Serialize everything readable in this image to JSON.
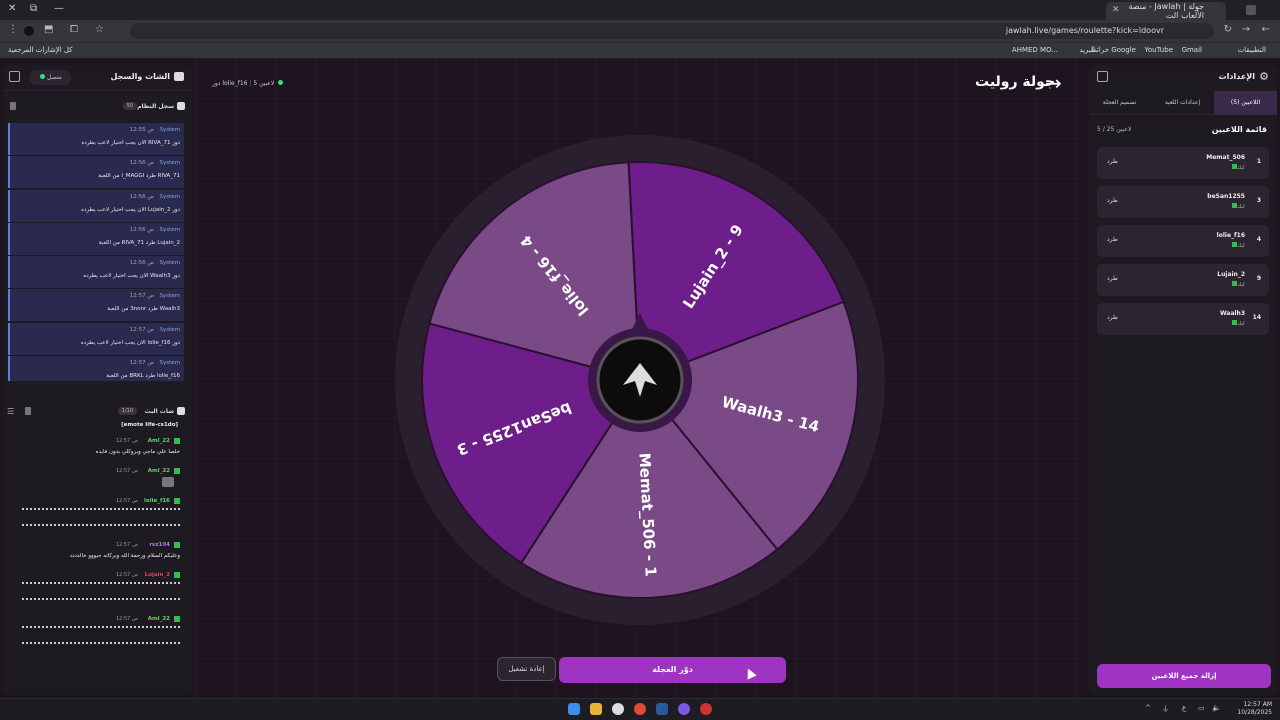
{
  "browser": {
    "tab_title": "جولة | Jawlah - منصة الألعاب الت",
    "url": "jawlah.live/games/roulette?kick=ldoovr",
    "bookmarks": [
      "التطبيقات",
      "Gmail",
      "YouTube",
      "خرائط Google",
      "البريد",
      "AHMED MO...",
      "كل الإشارات المرجعية"
    ]
  },
  "left_panel": {
    "title": "الشات والسجل",
    "online_label": "متصل",
    "system_log": {
      "title": "سجل النظام",
      "count": "50",
      "entries": [
        {
          "source": "System",
          "time": "12:55 ص",
          "message": "دور RIVA_71 الان يجب اختيار لاعب يطرده"
        },
        {
          "source": "System",
          "time": "12:56 ص",
          "message": "RIVA_71 طرد I_MAGGI من اللعبة"
        },
        {
          "source": "System",
          "time": "12:56 ص",
          "message": "دور Lujain_2 الان يجب اختيار لاعب يطرده"
        },
        {
          "source": "System",
          "time": "12:56 ص",
          "message": "Lujain_2 طرد RIVA_71 من اللعبة"
        },
        {
          "source": "System",
          "time": "12:56 ص",
          "message": "دور Waalh3 الان يجب اختيار لاعب يطرده"
        },
        {
          "source": "System",
          "time": "12:57 ص",
          "message": "Waalh3 طرد 3nonr من اللعبة"
        },
        {
          "source": "System",
          "time": "12:57 ص",
          "message": "دور lolie_f16 الان يجب اختيار لاعب يطرده"
        },
        {
          "source": "System",
          "time": "12:57 ص",
          "message": "lolie_f16 طرد BRKL من اللعبة"
        }
      ]
    },
    "chat": {
      "title": "شات البث",
      "count": "1/10",
      "top_line": "[emote life-cs1do]",
      "messages": [
        {
          "name": "Aml_22",
          "time": "12:57 ص",
          "text": "خلصا علي ماجي وبروكلي بدون فايده",
          "kind": "text"
        },
        {
          "name": "Aml_22",
          "time": "12:57 ص",
          "text": "",
          "kind": "emote"
        },
        {
          "name": "lolie_f16",
          "time": "12:57 ص",
          "text": "",
          "kind": "bars"
        },
        {
          "name": "rsz104",
          "time": "12:57 ص",
          "text": "وعليكم السلام ورحمة الله وبركاته حيووو خالدددد",
          "kind": "text"
        },
        {
          "name": "Lujain_2",
          "time": "12:57 ص",
          "text": "",
          "kind": "bars"
        },
        {
          "name": "Aml_22",
          "time": "12:57 ص",
          "text": "",
          "kind": "bars"
        }
      ]
    }
  },
  "center": {
    "title": "جولة روليت",
    "players_label": "5 لاعبين",
    "turn_label": "دور lolie_f16",
    "wheel_segments": [
      {
        "label": "lolie_f16 - 4",
        "color": "#7a4a86"
      },
      {
        "label": "Lujain_2 - 9",
        "color": "#6e1e8a"
      },
      {
        "label": "Waalh3 - 14",
        "color": "#7a4a86"
      },
      {
        "label": "Memat_506 - 1",
        "color": "#7a4a86"
      },
      {
        "label": "beSan1255 - 3",
        "color": "#6e1e8a"
      }
    ],
    "spin_button": "دوّر العجلة",
    "restart_button": "إعادة تشغيل"
  },
  "right_panel": {
    "title": "الإعدادات",
    "tabs": [
      "اللاعبين (5)",
      "إعدادات اللعبة",
      "تصميم العجلة"
    ],
    "players_title": "قائمة اللاعبين",
    "players_count": "5 / 25 لاعبين",
    "kick_label": "طرد",
    "players": [
      {
        "number": "1",
        "name": "Memat_506",
        "platform": "كيك"
      },
      {
        "number": "3",
        "name": "beSan1255",
        "platform": "كيك"
      },
      {
        "number": "4",
        "name": "lolie_f16",
        "platform": "كيك"
      },
      {
        "number": "9",
        "name": "Lujain_2",
        "platform": "كيك"
      },
      {
        "number": "14",
        "name": "Waalh3",
        "platform": "كيك"
      }
    ],
    "remove_all_button": "إزالة جميع اللاعبين"
  },
  "taskbar": {
    "time": "12:57 AM",
    "date": "10/28/2025",
    "lang": "ع"
  }
}
